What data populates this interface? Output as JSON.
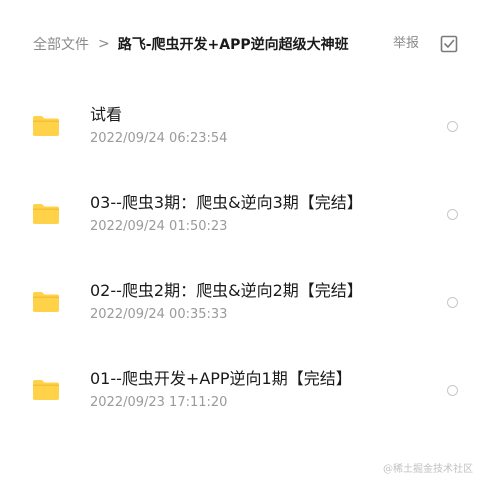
{
  "header": {
    "breadcrumb_root": "全部文件",
    "breadcrumb_separator": ">",
    "breadcrumb_current": "路飞-爬虫开发+APP逆向超级大神班",
    "report_label": "举报"
  },
  "colors": {
    "folder": "#ffd24a",
    "folder_tab": "#f5c033",
    "text_primary": "#1a1a1a",
    "text_secondary": "#9a9a9a"
  },
  "icons": {
    "folder": "folder-icon",
    "select": "checkbox-icon",
    "row_select": "radio-icon"
  },
  "files": [
    {
      "name": "试看",
      "date": "2022/09/24 06:23:54"
    },
    {
      "name": "03--爬虫3期：爬虫&逆向3期【完结】",
      "date": "2022/09/24 01:50:23"
    },
    {
      "name": "02--爬虫2期：爬虫&逆向2期【完结】",
      "date": "2022/09/24 00:35:33"
    },
    {
      "name": "01--爬虫开发+APP逆向1期【完结】",
      "date": "2022/09/23 17:11:20"
    }
  ],
  "watermark": "@稀土掘金技术社区"
}
